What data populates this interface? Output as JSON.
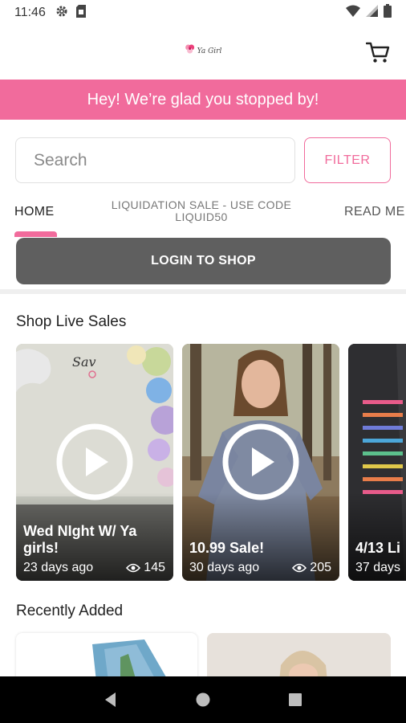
{
  "status_bar": {
    "time": "11:46",
    "icons": [
      "gear-icon",
      "sim-card-icon",
      "wifi-icon",
      "signal-icon",
      "battery-icon"
    ]
  },
  "header": {
    "logo_text": "Ya Girl",
    "icons": [
      "logo-flower-icon",
      "cart-icon"
    ]
  },
  "banner": {
    "text": "Hey! We’re glad you stopped by!",
    "color": "#f16b9c"
  },
  "search": {
    "placeholder": "Search",
    "value": ""
  },
  "filter": {
    "label": "FILTER"
  },
  "tabs": [
    {
      "label": "HOME",
      "active": true
    },
    {
      "label": "LIQUIDATION SALE - USE CODE LIQUID50",
      "active": false
    },
    {
      "label": "READ ME",
      "active": false
    }
  ],
  "login": {
    "label": "LOGIN TO SHOP"
  },
  "live_sales": {
    "title": "Shop Live Sales",
    "cards": [
      {
        "title": "Wed NIght W/ Ya girls!",
        "age": "23 days ago",
        "views": "145"
      },
      {
        "title": "10.99 Sale!",
        "age": "30 days ago",
        "views": "205"
      },
      {
        "title": "4/13 Li",
        "age": "37 days",
        "views": ""
      }
    ],
    "icons": [
      "play-icon",
      "eye-icon"
    ]
  },
  "recently_added": {
    "title": "Recently Added"
  },
  "nav_bar": {
    "icons": [
      "back-icon",
      "home-icon",
      "recents-icon"
    ]
  },
  "colors": {
    "accent": "#f16b9c",
    "login_button": "#5f5f5f",
    "nav_bar": "#000000"
  }
}
